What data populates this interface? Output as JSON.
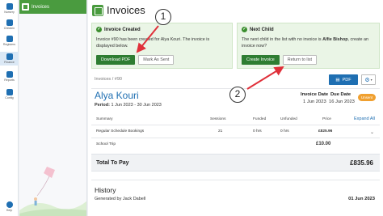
{
  "rail": [
    {
      "icon": "home-icon",
      "label": "Nursery"
    },
    {
      "icon": "child-icon",
      "label": "Children"
    },
    {
      "icon": "book-icon",
      "label": "Registers"
    },
    {
      "icon": "pound-icon",
      "label": "Finance"
    },
    {
      "icon": "chart-icon",
      "label": "Reports"
    },
    {
      "icon": "gear-icon",
      "label": "Config"
    },
    {
      "icon": "help-icon",
      "label": "Help"
    }
  ],
  "sidebar": {
    "heading": "Invoices"
  },
  "page": {
    "title": "Invoices"
  },
  "created_notice": {
    "title": "Invoice Created",
    "body": "Invoice #90 has been created for Alya Kouri. The invoice is displayed below.",
    "download_label": "Download PDF",
    "mark_sent_label": "Mark As Sent"
  },
  "next_notice": {
    "title": "Next Child",
    "body_prefix": "The next child in the list with no invoice is ",
    "child": "Alfie Bishop",
    "body_suffix": ", create an invoice now?",
    "create_label": "Create Invoice",
    "return_label": "Return to list"
  },
  "breadcrumb": {
    "parent": "Invoices",
    "sep": "/",
    "current": "#90"
  },
  "toolbar": {
    "pdf_label": "PDF"
  },
  "invoice": {
    "child": "Alya Kouri",
    "period_label": "Period:",
    "period": "1 Jun 2023 - 30 Jun 2023",
    "invoice_date_label": "Invoice Date",
    "invoice_date": "1 Jun 2023",
    "due_date_label": "Due Date",
    "due_date": "16 Jun 2023",
    "status": "Unsent"
  },
  "table": {
    "headers": [
      "Summary",
      "Sessions",
      "Funded",
      "Unfunded",
      "Price"
    ],
    "expand_label": "Expand All",
    "rows": [
      {
        "summary": "Regular Schedule Bookings",
        "sessions": "21",
        "funded": "0 hrs",
        "unfunded": "0 hrs",
        "price": "£825.96"
      },
      {
        "summary": "School Trip",
        "sessions": "",
        "funded": "",
        "unfunded": "",
        "price": "£10.00"
      }
    ],
    "total_label": "Total To Pay",
    "total": "£835.96"
  },
  "history": {
    "title": "History",
    "by": "Generated by Jack Dabell",
    "date": "01 Jun 2023"
  },
  "annotations": {
    "marker1": "1",
    "marker2": "2",
    "arrow_color": "#e0303a"
  },
  "colors": {
    "green": "#4a9b3f",
    "blue": "#1f6fb2",
    "orange": "#f0a030"
  }
}
